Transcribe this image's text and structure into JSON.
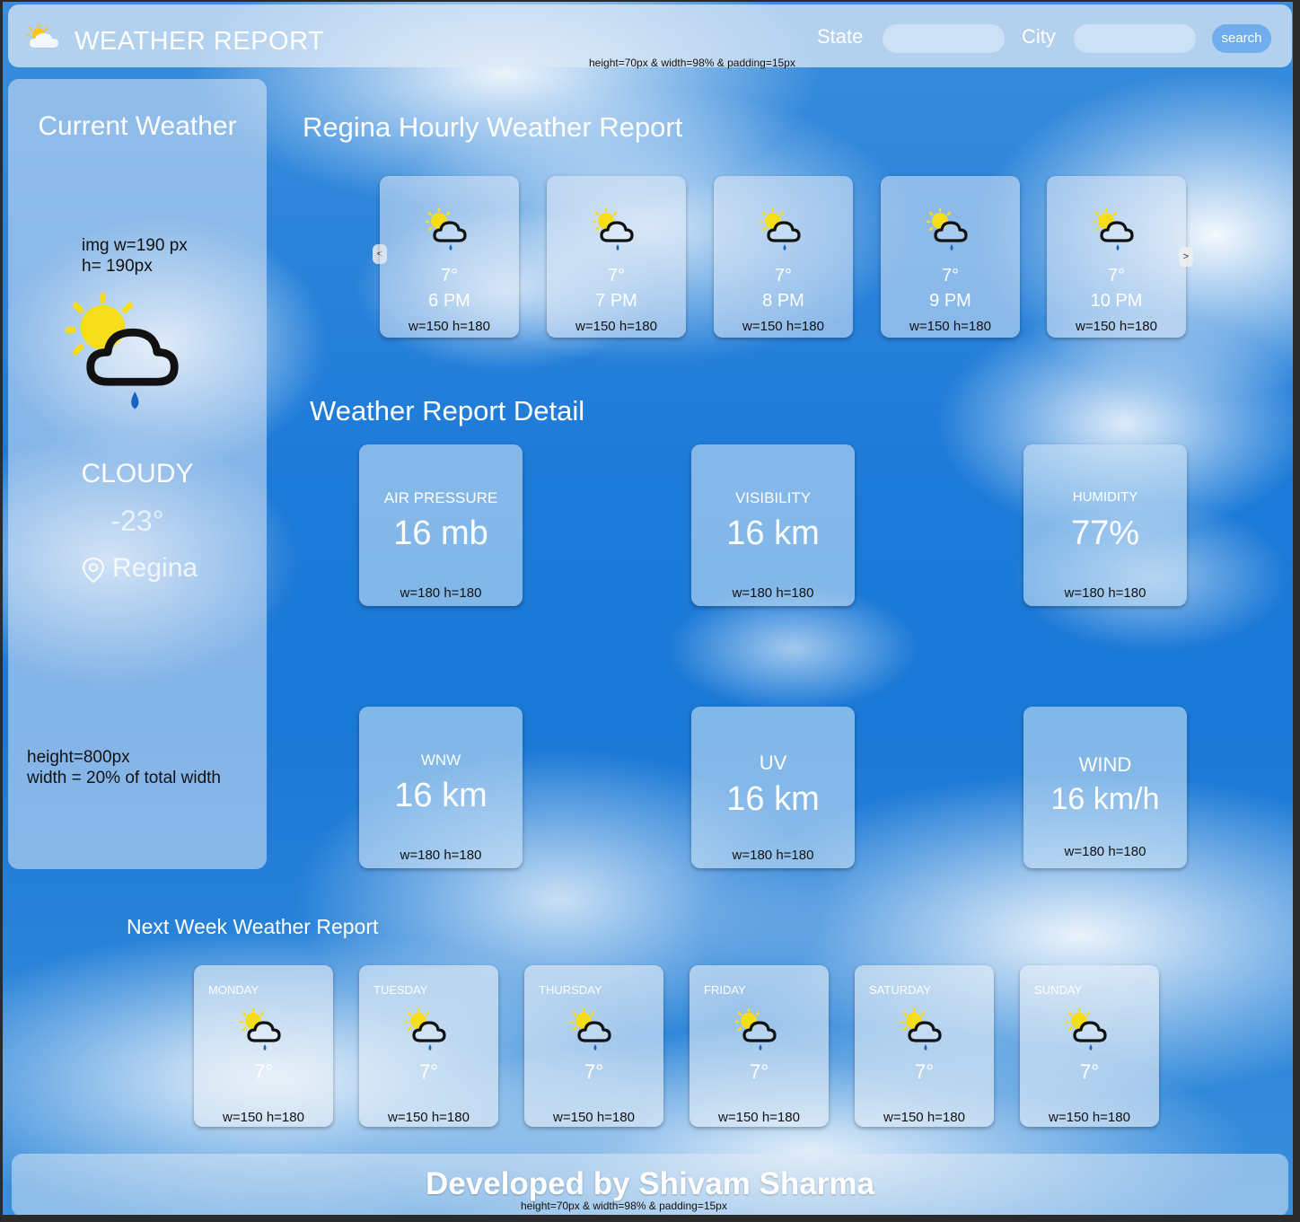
{
  "header": {
    "title": "WEATHER REPORT",
    "state_label": "State",
    "city_label": "City",
    "state_value": "",
    "city_value": "",
    "search_label": "search",
    "note": "height=70px & width=98% & padding=15px"
  },
  "current": {
    "heading": "Current Weather",
    "img_note_1": "img w=190 px",
    "img_note_2": "h= 190px",
    "condition": "CLOUDY",
    "temperature": "-23°",
    "location": "Regina",
    "size_note_1": "height=800px",
    "size_note_2": "width = 20% of total width",
    "icon": "partly-cloudy-rain-icon"
  },
  "hourly": {
    "title": "Regina Hourly Weather Report",
    "prev_label": "<",
    "next_label": ">",
    "items": [
      {
        "temp": "7°",
        "time": "6 PM",
        "note": "w=150 h=180"
      },
      {
        "temp": "7°",
        "time": "7 PM",
        "note": "w=150 h=180"
      },
      {
        "temp": "7°",
        "time": "8 PM",
        "note": "w=150 h=180"
      },
      {
        "temp": "7°",
        "time": "9 PM",
        "note": "w=150 h=180"
      },
      {
        "temp": "7°",
        "time": "10 PM",
        "note": "w=150 h=180"
      }
    ]
  },
  "detail": {
    "title": "Weather Report Detail",
    "items": [
      {
        "label": "AIR PRESSURE",
        "value": "16 mb",
        "note": "w=180 h=180"
      },
      {
        "label": "VISIBILITY",
        "value": "16 km",
        "note": "w=180 h=180"
      },
      {
        "label": "HUMIDITY",
        "value": "77%",
        "note": "w=180 h=180"
      },
      {
        "label": "WNW",
        "value": "16 km",
        "note": "w=180 h=180"
      },
      {
        "label": "UV",
        "value": "16 km",
        "note": "w=180 h=180"
      },
      {
        "label": "WIND",
        "value": "16 km/h",
        "note": "w=180 h=180"
      }
    ]
  },
  "weekly": {
    "title": "Next Week Weather Report",
    "items": [
      {
        "day": "MONDAY",
        "temp": "7°",
        "note": "w=150 h=180"
      },
      {
        "day": "TUESDAY",
        "temp": "7°",
        "note": "w=150 h=180"
      },
      {
        "day": "THURSDAY",
        "temp": "7°",
        "note": "w=150 h=180"
      },
      {
        "day": "FRIDAY",
        "temp": "7°",
        "note": "w=150 h=180"
      },
      {
        "day": "SATURDAY",
        "temp": "7°",
        "note": "w=150 h=180"
      },
      {
        "day": "SUNDAY",
        "temp": "7°",
        "note": "w=150 h=180"
      }
    ]
  },
  "footer": {
    "text": "Developed by Shivam Sharma",
    "note": "height=70px & width=98% & padding=15px"
  }
}
